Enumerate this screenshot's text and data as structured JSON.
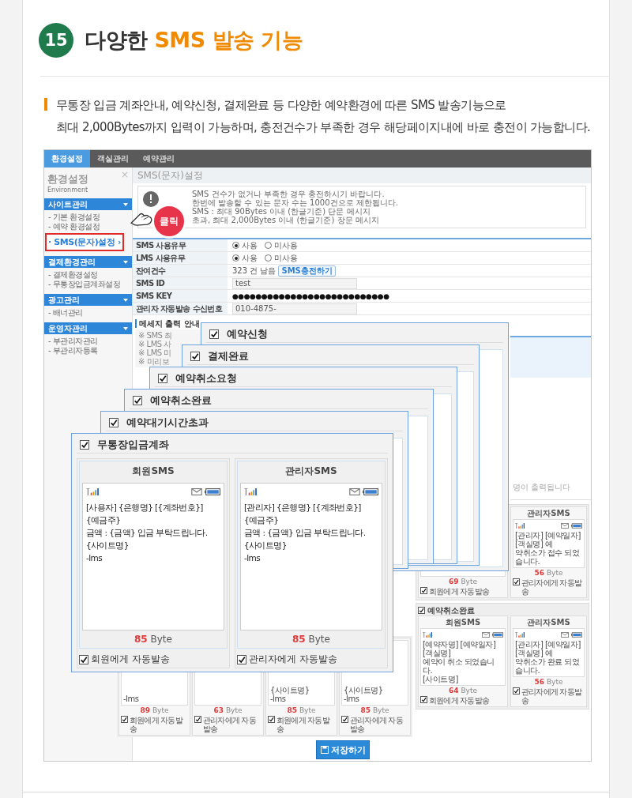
{
  "header": {
    "number": "15",
    "title_plain": "다양한",
    "title_accent": "SMS 발송 기능"
  },
  "description": [
    "무통장 입금 계좌안내, 예약신청, 결제완료 등 다양한 예약환경에 따른 SMS 발송기능으로",
    "최대 2,000Bytes까지 입력이 가능하며, 충전건수가 부족한 경우 해당페이지내에 바로 충전이 가능합니다."
  ],
  "screenshot": {
    "nav_tabs": [
      {
        "label": "환경설정",
        "selected": true
      },
      {
        "label": "객실관리",
        "selected": false
      },
      {
        "label": "예약관리",
        "selected": false
      }
    ],
    "sidebar": {
      "title": "환경설정",
      "subtitle": "Environment",
      "close": "×",
      "groups": [
        {
          "label": "사이트관리",
          "items": [
            "- 기본 환경설정",
            "- 예약 환경설정"
          ],
          "callout": "· SMS(문자)설정 ›"
        },
        {
          "label": "결제환경관리",
          "items": [
            "- 결제환경설정",
            "- 무통장입금계좌설정"
          ]
        },
        {
          "label": "광고관리",
          "items": [
            "- 배너관리"
          ]
        },
        {
          "label": "운영자관리",
          "items": [
            "- 부관리자관리",
            "- 부관리자등록"
          ]
        }
      ]
    },
    "click_badge": "클릭",
    "panel_title": "SMS(문자)설정",
    "notice": [
      "SMS 건수가 없거나 부족한 경우 충전하시기 바랍니다.",
      "한번에 발송할 수 있는 문자 수는 1000건으로 제한됩니다.",
      "SMS : 최대 90Bytes 이내 (한글기준) 단문 메시지",
      "초과, 최대 2,000Bytes 이내 (한글기준) 장문 메시지"
    ],
    "form_rows": [
      {
        "label": "SMS 사용유무",
        "kind": "radio",
        "options": [
          {
            "label": "사용",
            "selected": true
          },
          {
            "label": "미사용",
            "selected": false
          }
        ]
      },
      {
        "label": "LMS 사용유무",
        "kind": "radio",
        "options": [
          {
            "label": "사용",
            "selected": true
          },
          {
            "label": "미사용",
            "selected": false
          }
        ]
      },
      {
        "label": "잔여건수",
        "kind": "count",
        "value": "323 건 남음",
        "button": "SMS충전하기"
      },
      {
        "label": "SMS ID",
        "kind": "input",
        "value": "test"
      },
      {
        "label": "SMS KEY",
        "kind": "password",
        "value": "●●●●●●●●●●●●●●●●●●●●●●●●●●●"
      },
      {
        "label": "관리자 자동발송 수신번호",
        "kind": "input",
        "value": "010-4875-"
      }
    ],
    "guide": {
      "title": "메세지 출력 안내",
      "lines": [
        "※ SMS 최",
        "※ LMS 사",
        "※ LMS 미",
        "※ 미리보"
      ]
    },
    "guide_note": "명이 출력됩니다",
    "stacked_cards": [
      {
        "title": "예약신청",
        "checked": true
      },
      {
        "title": "결제완료",
        "checked": true
      },
      {
        "title": "예약취소요청",
        "checked": true
      },
      {
        "title": "예약취소완료",
        "checked": true
      },
      {
        "title": "예약대기시간초과",
        "checked": true
      }
    ],
    "front_card": {
      "title": "무통장입금계좌",
      "checked": true,
      "columns": [
        {
          "title": "회원SMS",
          "lines": [
            "[사용자] {은행명} [{계좌번호}]",
            "{예금주}",
            "금액 : {금액} 입금 부탁드립니다.",
            "{사이트명}",
            "-lms"
          ],
          "bytes": "85",
          "unit": "Byte",
          "auto_send": {
            "label": "회원에게 자동발송",
            "checked": true
          }
        },
        {
          "title": "관리자SMS",
          "lines": [
            "[관리자] {은행명} [{계좌번호}]",
            "{예금주}",
            "금액 : {금액} 입금 부탁드립니다.",
            "{사이트명}",
            "-lms"
          ],
          "bytes": "85",
          "unit": "Byte",
          "auto_send": {
            "label": "관리자에게 자동발송",
            "checked": true
          }
        }
      ]
    },
    "bottom_cards": [
      {
        "lines": [
          "-lms"
        ],
        "bytes": "89",
        "unit": "Byte",
        "auto_send": {
          "label": "회원에게 자동발송",
          "checked": true
        }
      },
      {
        "bytes": "63",
        "unit": "Byte",
        "auto_send": {
          "label": "관리자에게 자동발송",
          "checked": true
        }
      },
      {
        "lines": [
          "{사이트명}",
          "-lms"
        ],
        "bytes": "85",
        "unit": "Byte",
        "auto_send": {
          "label": "회원에게 자동발송",
          "checked": true
        }
      },
      {
        "lines": [
          "{사이트명}",
          "-lms"
        ],
        "bytes": "85",
        "unit": "Byte",
        "auto_send": {
          "label": "관리자에게 자동발송",
          "checked": true
        }
      }
    ],
    "right_panels": [
      {
        "cards": [
          {
            "bytes": "69",
            "unit": "Byte",
            "auto_send": {
              "label": "회원에게 자동발송",
              "checked": true
            }
          },
          {
            "title": "관리자SMS",
            "lines": [
              "[관리자] [예약일자] [객실명] 예",
              "약취소가 접수 되었습니다."
            ],
            "bytes": "56",
            "unit": "Byte",
            "auto_send": {
              "label": "관리자에게 자동발송",
              "checked": true
            }
          }
        ]
      },
      {
        "title": "예약취소완료",
        "checked": true,
        "cards": [
          {
            "title": "회원SMS",
            "lines": [
              "[예약자명] [예약일자] [객실명]",
              "예약이 취소 되었습니다.",
              "[사이트명]"
            ],
            "bytes": "64",
            "unit": "Byte",
            "auto_send": {
              "label": "회원에게 자동발송",
              "checked": true
            }
          },
          {
            "title": "관리자SMS",
            "lines": [
              "[관리자] [예약일자] [객실명] 예",
              "약취소가 완료 되었습니다."
            ],
            "bytes": "56",
            "unit": "Byte",
            "auto_send": {
              "label": "관리자에게 자동발송",
              "checked": true
            }
          }
        ]
      }
    ],
    "save_button": "저장하기"
  }
}
